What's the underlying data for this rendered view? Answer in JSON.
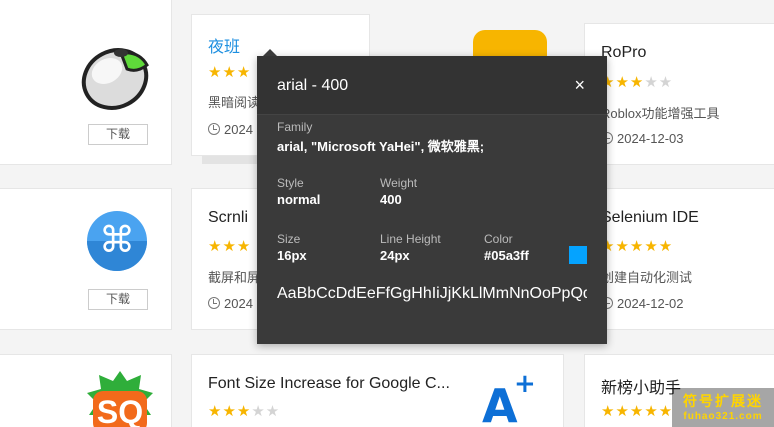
{
  "cards": {
    "mouse": {
      "download_label": "下载"
    },
    "yeban": {
      "title": "夜班",
      "stars_on": "★★★",
      "desc": "黑暗阅读",
      "date": "2024"
    },
    "ropro": {
      "title": "RoPro",
      "stars_on": "★★★",
      "stars_off": "★★",
      "desc": "Roblox功能增强工具",
      "date": "2024-12-03"
    },
    "cmd": {
      "download_label": "下载"
    },
    "scrnli": {
      "title": "Scrnli",
      "stars_on": "★★★",
      "desc": "截屏和屏",
      "date": "2024"
    },
    "selenium": {
      "title": "Selenium IDE",
      "stars_on": "★★★★★",
      "desc": "创建自动化测试",
      "date": "2024-12-02"
    },
    "sq": {},
    "fontsize": {
      "title": "Font Size Increase for Google C...",
      "stars_on": "★★★",
      "stars_off": "★★"
    },
    "xinbang": {
      "title": "新榜小助手",
      "stars_on": "★★★★★"
    }
  },
  "font_panel": {
    "title": "arial - 400",
    "close_glyph": "×",
    "family_label": "Family",
    "family_value": "arial, \"Microsoft YaHei\", 微软雅黑;",
    "style_label": "Style",
    "style_value": "normal",
    "weight_label": "Weight",
    "weight_value": "400",
    "size_label": "Size",
    "size_value": "16px",
    "line_height_label": "Line Height",
    "line_height_value": "24px",
    "color_label": "Color",
    "color_value": "#05a3ff",
    "sample_text": "AaBbCcDdEeFfGgHhIiJjKkLlMmNnOoPpQqRrSsTtUuVvWwXxYyZz"
  },
  "watermark": {
    "line1": "符号扩展迷",
    "line2": "fuhao321.com"
  },
  "icons": {
    "mouse": "mouse-icon",
    "moon": "moon-icon",
    "command": "command-key-icon",
    "sq": "sq-logo-icon",
    "font_size": "font-size-a-plus-icon"
  },
  "colors": {
    "accent": "#1d8fe0",
    "star": "#f7b500",
    "panel_bg": "#3a3a3a",
    "swatch": "#05a3ff"
  }
}
